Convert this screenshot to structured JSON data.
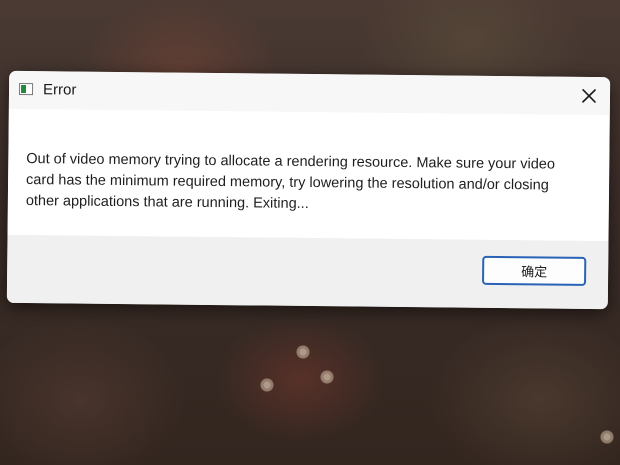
{
  "dialog": {
    "title": "Error",
    "message": "Out of video memory trying to allocate a rendering resource. Make sure your video card has the minimum required memory, try lowering the resolution and/or closing other applications that are running. Exiting...",
    "ok_label": "确定",
    "icons": {
      "app": "app-window-icon",
      "close": "close-icon"
    }
  },
  "colors": {
    "accent": "#2a62b6",
    "app_icon_green": "#1f8a3a"
  }
}
